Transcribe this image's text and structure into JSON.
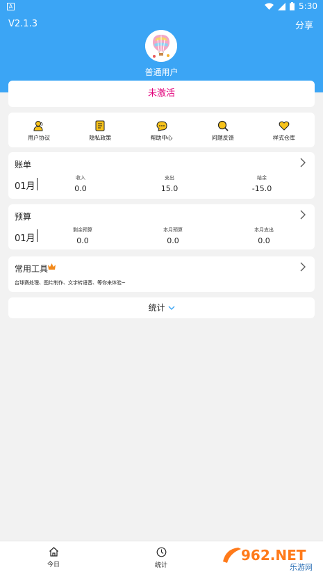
{
  "status_bar": {
    "left_icon": "A",
    "time": "5:30",
    "icons": [
      "wifi-icon",
      "signal-icon",
      "battery-icon"
    ]
  },
  "header": {
    "version": "V2.1.3",
    "share_label": "分享",
    "username": "普通用户"
  },
  "activation": {
    "label": "未激活",
    "color": "#e2007a"
  },
  "menu": {
    "items": [
      {
        "label": "用户协议",
        "icon": "user-icon"
      },
      {
        "label": "隐私政策",
        "icon": "document-icon"
      },
      {
        "label": "帮助中心",
        "icon": "chat-bubble-icon"
      },
      {
        "label": "问题反馈",
        "icon": "search-icon"
      },
      {
        "label": "样式仓库",
        "icon": "heart-icon"
      }
    ]
  },
  "bill": {
    "title": "账单",
    "month": "01月",
    "stats": [
      {
        "label": "收入",
        "value": "0.0"
      },
      {
        "label": "支出",
        "value": "15.0"
      },
      {
        "label": "结余",
        "value": "-15.0"
      }
    ]
  },
  "budget": {
    "title": "预算",
    "month": "01月",
    "stats": [
      {
        "label": "剩余预算",
        "value": "0.0"
      },
      {
        "label": "本月预算",
        "value": "0.0"
      },
      {
        "label": "本月支出",
        "value": "0.0"
      }
    ]
  },
  "tools": {
    "title": "常用工具",
    "desc": "台球赛处理、图片制作、文字转语音、等你来体验~"
  },
  "stats_toggle": {
    "label": "统计"
  },
  "bottom_nav": {
    "items": [
      {
        "label": "今日",
        "icon": "home-icon"
      },
      {
        "label": "统计",
        "icon": "clock-icon"
      }
    ]
  },
  "watermark": {
    "text": "962.NET",
    "subtext": "乐游网"
  },
  "colors": {
    "header": "#3ba5f5",
    "accent": "#e2007a",
    "icon_yellow": "#f7c21a",
    "chevron": "#3ba5f5"
  }
}
